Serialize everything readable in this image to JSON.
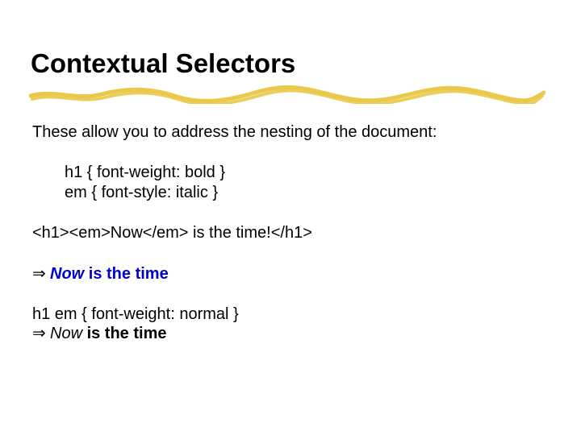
{
  "title": "Contextual Selectors",
  "intro": "These allow you to address the nesting of the document:",
  "css_rules": {
    "line1": "h1 { font-weight: bold }",
    "line2": "em { font-style: italic }"
  },
  "markup_example": "<h1><em>Now</em> is the time!</h1>",
  "result1": {
    "arrow": "⇒",
    "now": "Now",
    "rest": " is the time"
  },
  "contextual_rule": "h1 em { font-weight: normal }",
  "result2": {
    "arrow": "⇒",
    "now": "Now",
    "rest": " is the time"
  },
  "colors": {
    "underline": "#e9c84a",
    "link_blue": "#0000cc"
  }
}
